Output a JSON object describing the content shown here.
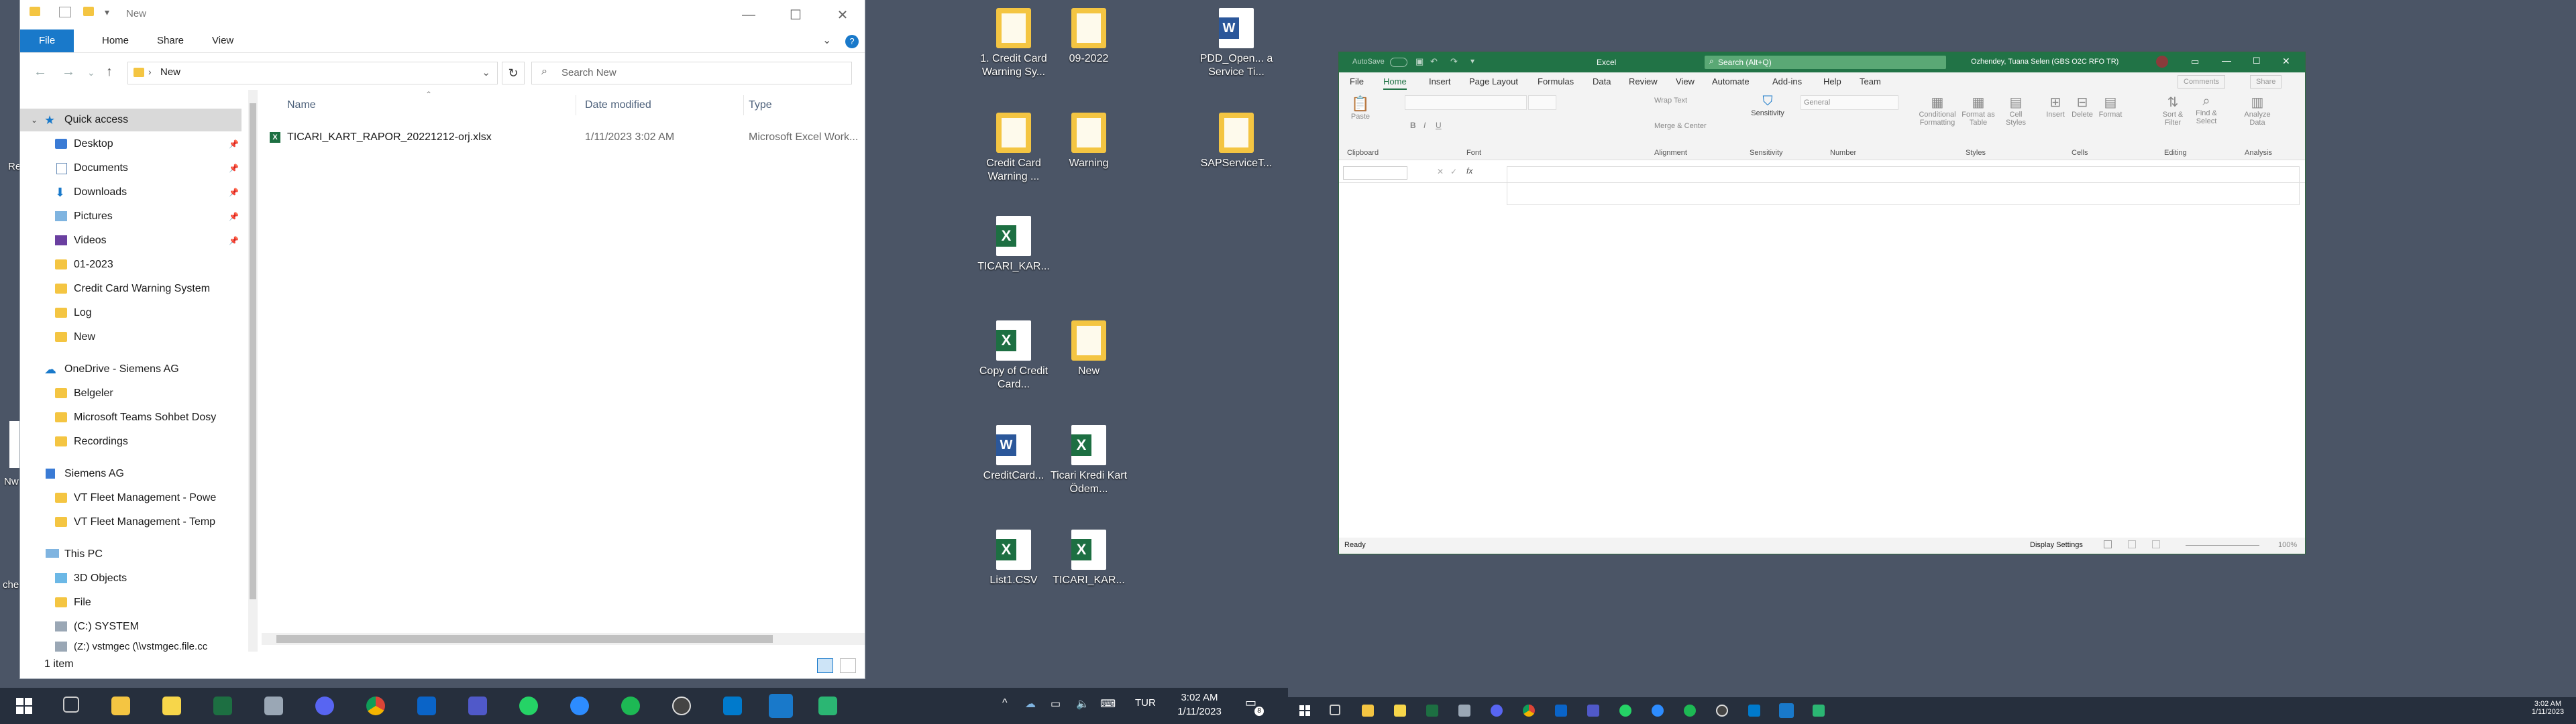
{
  "explorer": {
    "title": "New",
    "ribbon_tabs": [
      "File",
      "Home",
      "Share",
      "View"
    ],
    "address": "New",
    "search_placeholder": "Search New",
    "nav": {
      "quick_access": "Quick access",
      "items": [
        {
          "label": "Desktop",
          "icon": "desktop-folder-icon",
          "pinned": true
        },
        {
          "label": "Documents",
          "icon": "documents-folder-icon",
          "pinned": true
        },
        {
          "label": "Downloads",
          "icon": "downloads-folder-icon",
          "pinned": true
        },
        {
          "label": "Pictures",
          "icon": "pictures-folder-icon",
          "pinned": true
        },
        {
          "label": "Videos",
          "icon": "videos-folder-icon",
          "pinned": true
        },
        {
          "label": "01-2023",
          "icon": "folder-icon"
        },
        {
          "label": "Credit Card Warning System",
          "icon": "folder-icon"
        },
        {
          "label": "Log",
          "icon": "folder-icon"
        },
        {
          "label": "New",
          "icon": "folder-icon"
        }
      ],
      "onedrive": "OneDrive - Siemens AG",
      "onedrive_items": [
        "Belgeler",
        "Microsoft Teams Sohbet Dosy",
        "Recordings"
      ],
      "siemens": "Siemens AG",
      "siemens_items": [
        "VT Fleet Management - Powe",
        "VT Fleet Management - Temp"
      ],
      "this_pc": "This PC",
      "pc_items": [
        "3D Objects",
        "File",
        "(C:) SYSTEM",
        "(Z:) vstmgec (\\\\vstmgec.file.cc"
      ]
    },
    "columns": {
      "name": "Name",
      "date": "Date modified",
      "type": "Type"
    },
    "files": [
      {
        "name": "TICARI_KART_RAPOR_20221212-orj.xlsx",
        "date": "1/11/2023 3:02 AM",
        "type": "Microsoft Excel Work..."
      }
    ],
    "status": "1 item"
  },
  "desktop": {
    "left_labels": [
      "Re",
      "Nw",
      "che"
    ],
    "icons": [
      {
        "label": "1. Credit Card Warning Sy...",
        "kind": "folder"
      },
      {
        "label": "09-2022",
        "kind": "folder"
      },
      {
        "label": "PDD_Open... a Service Ti...",
        "kind": "word"
      },
      {
        "label": "Credit Card Warning ...",
        "kind": "folder"
      },
      {
        "label": "Warning",
        "kind": "folder"
      },
      {
        "label": "SAPServiceT...",
        "kind": "folder"
      },
      {
        "label": "TICARI_KAR...",
        "kind": "excel"
      },
      {
        "label": "Copy of Credit Card...",
        "kind": "excel"
      },
      {
        "label": "New",
        "kind": "folder"
      },
      {
        "label": "CreditCard...",
        "kind": "word"
      },
      {
        "label": "Ticari Kredi Kart Ödem...",
        "kind": "excel"
      },
      {
        "label": "List1.CSV",
        "kind": "excel"
      },
      {
        "label": "TICARI_KAR...",
        "kind": "excel"
      }
    ]
  },
  "excel": {
    "autosave": "AutoSave",
    "title": "Excel",
    "search": "Search (Alt+Q)",
    "user": "Ozhendey, Tuana Selen (GBS O2C RFO TR)",
    "tabs": [
      "File",
      "Home",
      "Insert",
      "Page Layout",
      "Formulas",
      "Data",
      "Review",
      "View",
      "Automate",
      "Add-ins",
      "Help",
      "Team"
    ],
    "comments": "Comments",
    "share": "Share",
    "groups": [
      "Clipboard",
      "Font",
      "Alignment",
      "Sensitivity",
      "Number",
      "Styles",
      "Cells",
      "Editing",
      "Analysis"
    ],
    "ribbon_labels": {
      "paste": "Paste",
      "wrap": "Wrap Text",
      "merge": "Merge & Center",
      "sensitivity": "Sensitivity",
      "number_format": "General",
      "conditional": "Conditional Formatting",
      "format_table": "Format as Table",
      "cell_styles": "Cell Styles",
      "insert": "Insert",
      "delete": "Delete",
      "format": "Format",
      "sort": "Sort & Filter",
      "find": "Find & Select",
      "analyze": "Analyze Data"
    },
    "status_ready": "Ready",
    "display_settings": "Display Settings",
    "zoom": "100%"
  },
  "taskbar": {
    "lang": "TUR",
    "time": "3:02 AM",
    "date": "1/11/2023",
    "notif_count": "8",
    "apps": [
      "start",
      "search",
      "task-view",
      "file-explorer",
      "sticky-notes",
      "excel",
      "pen",
      "discord",
      "chrome",
      "outlook",
      "teams",
      "whatsapp",
      "zoom",
      "spotify",
      "obs",
      "vscode",
      "sap",
      "project"
    ]
  },
  "colors": {
    "desktop": "#4b5566",
    "excel_green": "#217346",
    "explorer_file_tab": "#1979ca",
    "taskbar": "#262f3d"
  }
}
